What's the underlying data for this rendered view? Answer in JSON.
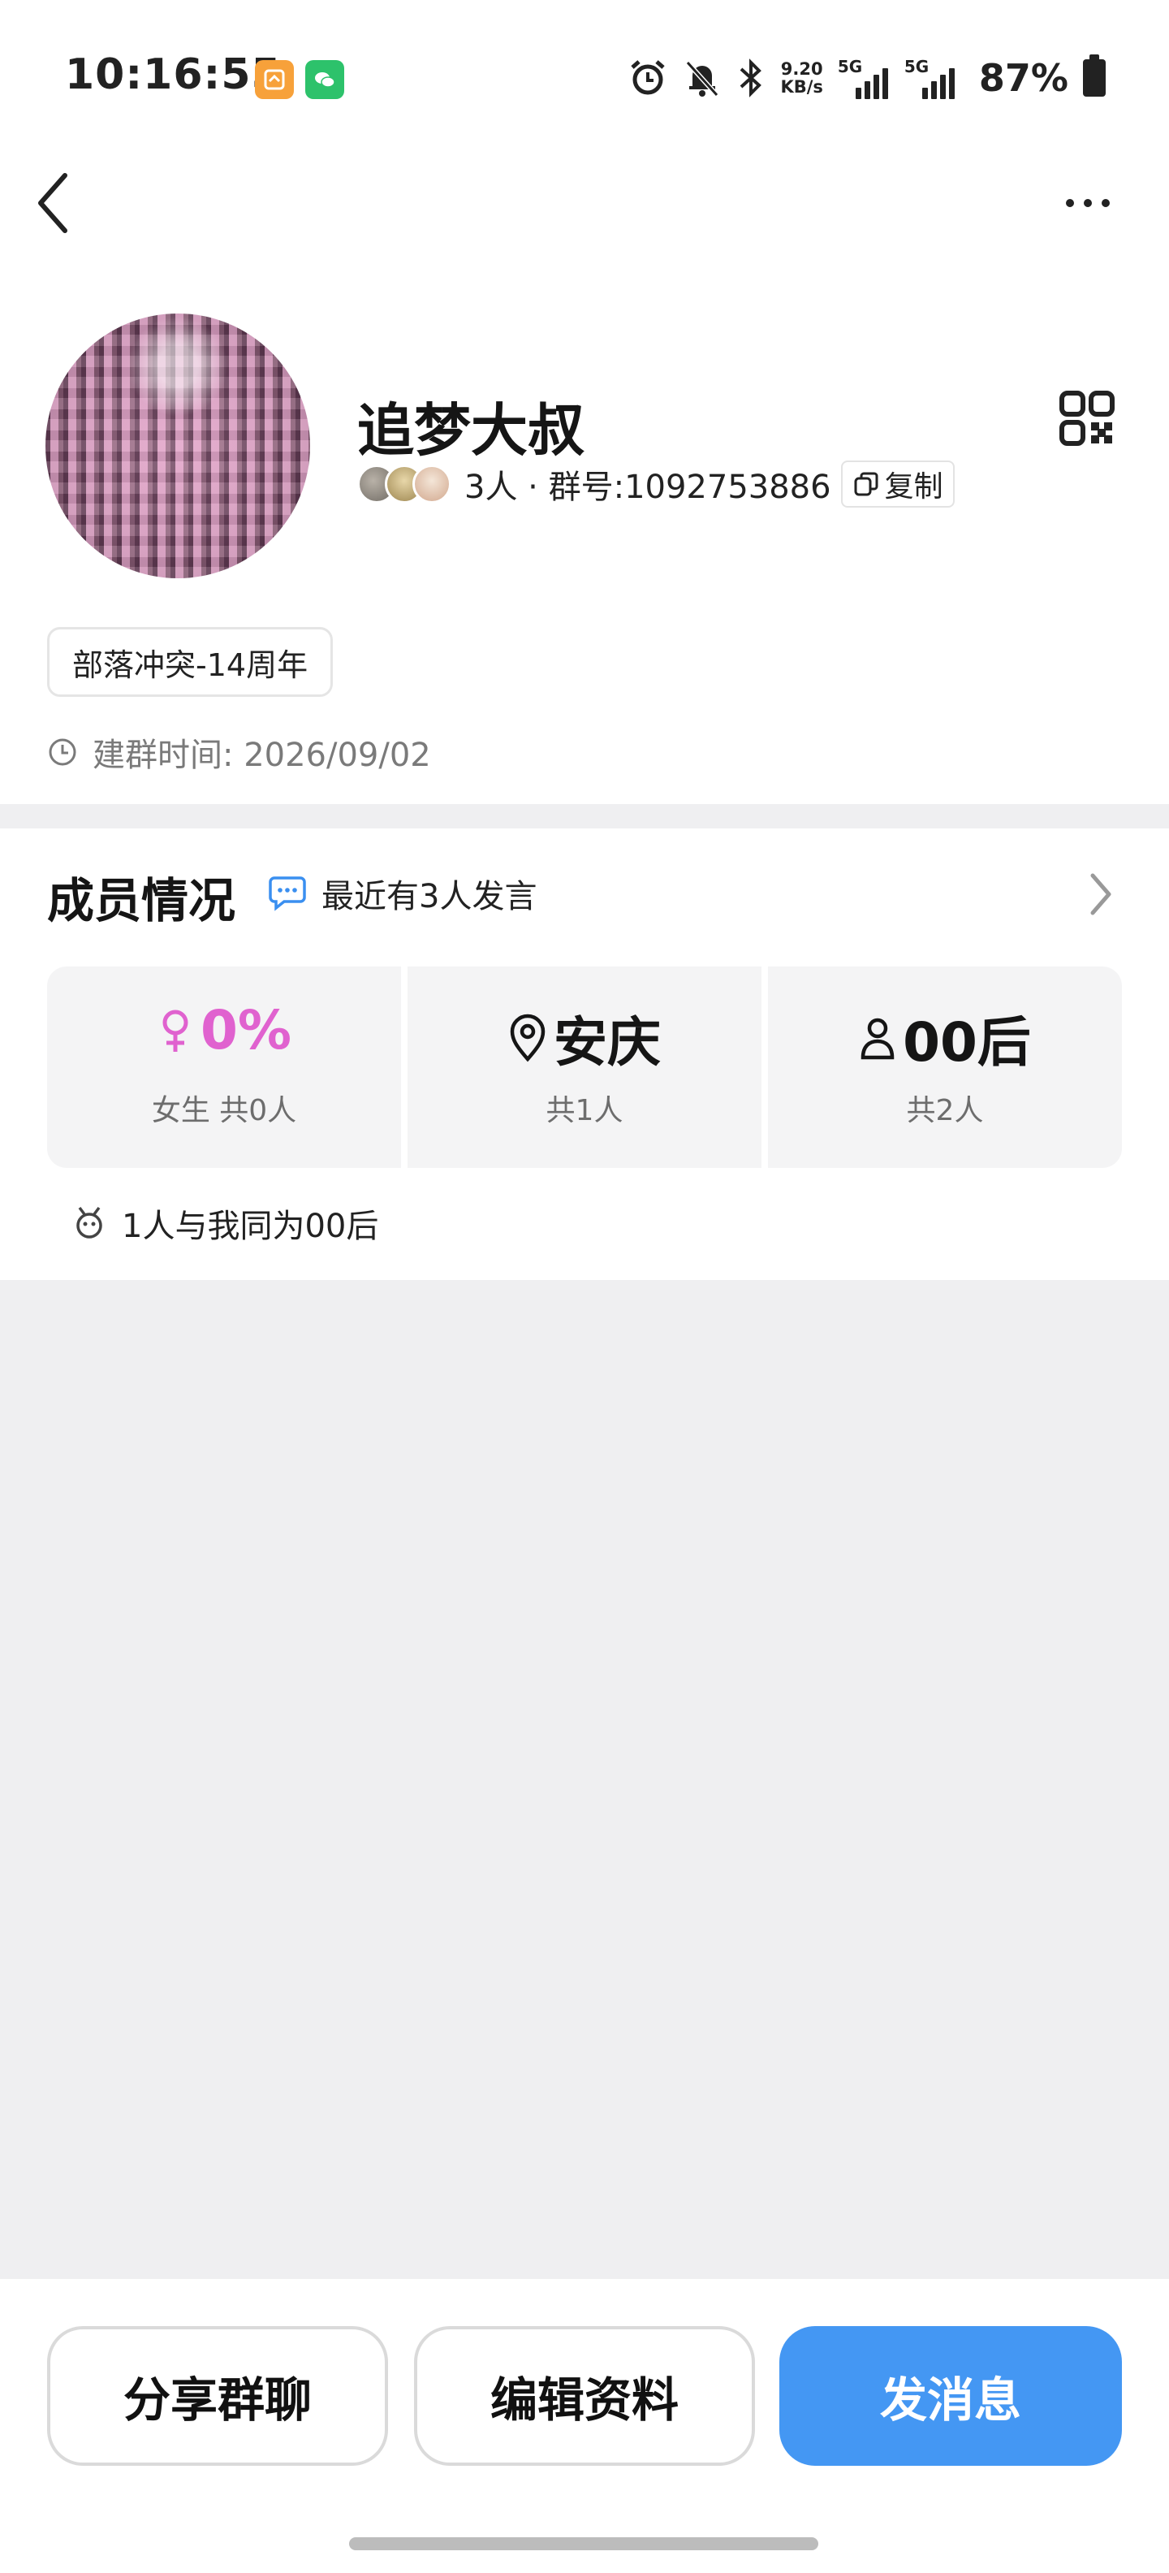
{
  "status_bar": {
    "time": "10:16:55",
    "speed_value": "9.20",
    "speed_unit": "KB/s",
    "net1": "5G",
    "net2": "5G",
    "battery": "87%"
  },
  "group": {
    "name": "追梦大叔",
    "member_info": "3人 · 群号:1092753886",
    "copy_label": "复制",
    "tag": "部落冲突-14周年",
    "created": "建群时间: 2026/09/02"
  },
  "members": {
    "title": "成员情况",
    "recent": "最近有3人发言",
    "stats": [
      {
        "value": "0%",
        "sub": "女生 共0人"
      },
      {
        "value": "安庆",
        "sub": "共1人"
      },
      {
        "value": "00后",
        "sub": "共2人"
      }
    ],
    "same_age": "1人与我同为00后"
  },
  "actions": {
    "share": "分享群聊",
    "edit": "编辑资料",
    "message": "发消息"
  },
  "colors": {
    "primary": "#4497f3",
    "female": "#e062cf",
    "background": "#efeff1"
  },
  "icons": [
    "back-icon",
    "more-icon",
    "qr-code-icon",
    "copy-icon",
    "clock-icon",
    "chat-bubble-icon",
    "chevron-right-icon",
    "female-icon",
    "location-pin-icon",
    "person-icon",
    "zodiac-icon"
  ]
}
